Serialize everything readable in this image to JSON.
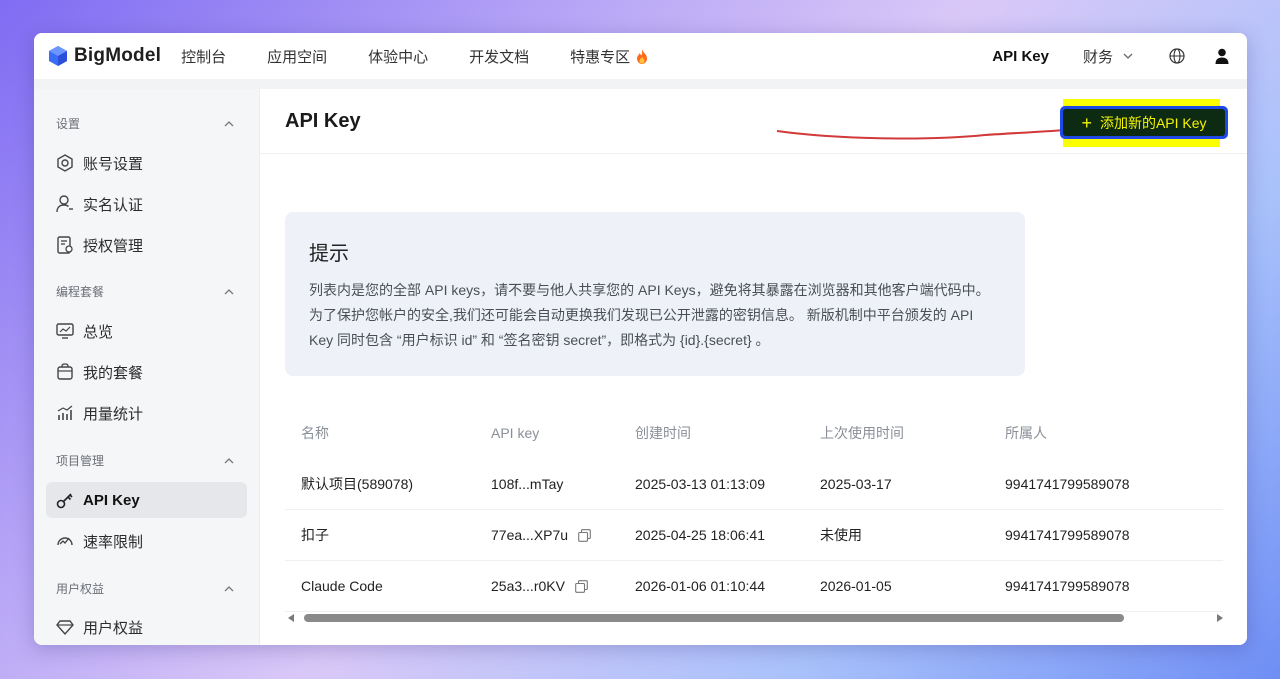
{
  "brand": {
    "name": "BigModel"
  },
  "nav": {
    "items": [
      "控制台",
      "应用空间",
      "体验中心",
      "开发文档",
      "特惠专区"
    ],
    "api_key": "API Key",
    "finance": "财务"
  },
  "sidebar": {
    "sections": [
      {
        "title": "设置",
        "items": [
          "账号设置",
          "实名认证",
          "授权管理"
        ]
      },
      {
        "title": "编程套餐",
        "items": [
          "总览",
          "我的套餐",
          "用量统计"
        ]
      },
      {
        "title": "项目管理",
        "items": [
          "API Key",
          "速率限制"
        ]
      },
      {
        "title": "用户权益",
        "items": [
          "用户权益"
        ]
      }
    ],
    "active_item": "API Key"
  },
  "main": {
    "title": "API Key",
    "add_button": "添加新的API Key",
    "tip": {
      "title": "提示",
      "body": "列表内是您的全部 API keys，请不要与他人共享您的 API Keys，避免将其暴露在浏览器和其他客户端代码中。为了保护您帐户的安全,我们还可能会自动更换我们发现已公开泄露的密钥信息。 新版机制中平台颁发的 API Key 同时包含 “用户标识 id” 和 “签名密钥 secret”，即格式为 {id}.{secret} 。"
    },
    "table": {
      "headers": [
        "名称",
        "API key",
        "创建时间",
        "上次使用时间",
        "所属人"
      ],
      "rows": [
        [
          "默认项目(589078)",
          "108f...mTay",
          "2025-03-13 01:13:09",
          "2025-03-17",
          "9941741799589078"
        ],
        [
          "扣子",
          "77ea...XP7u",
          "2025-04-25 18:06:41",
          "未使用",
          "9941741799589078"
        ],
        [
          "Claude Code",
          "25a3...r0KV",
          "2026-01-06 01:10:44",
          "2026-01-05",
          "9941741799589078"
        ]
      ]
    }
  },
  "colors": {
    "accent": "#1f49e4",
    "highlight": "#fcff00",
    "annotation_arrow": "#d23a3a"
  }
}
